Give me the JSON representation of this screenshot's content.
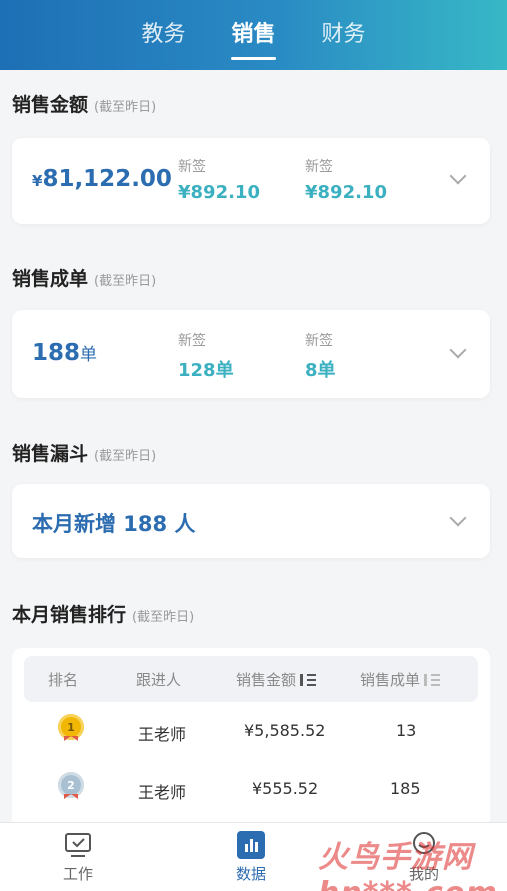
{
  "tabs": [
    "教务",
    "销售",
    "财务"
  ],
  "sales_amount": {
    "title": "销售金额",
    "subtitle": "(截至昨日)",
    "currency": "¥",
    "value": "81,122.00",
    "col1_label": "新签",
    "col1_value": "¥892.10",
    "col2_label": "新签",
    "col2_value": "¥892.10"
  },
  "sales_orders": {
    "title": "销售成单",
    "subtitle": "(截至昨日)",
    "value": "188",
    "unit": "单",
    "col1_label": "新签",
    "col1_value": "128单",
    "col2_label": "新签",
    "col2_value": "8单"
  },
  "funnel": {
    "title": "销售漏斗",
    "subtitle": "(截至昨日)",
    "text": "本月新增 188 人"
  },
  "ranking": {
    "title": "本月销售排行",
    "subtitle": "(截至昨日)",
    "headers": [
      "排名",
      "跟进人",
      "销售金额",
      "销售成单"
    ],
    "rows": [
      {
        "rank": "1",
        "name": "王老师",
        "amount": "¥5,585.52",
        "orders": "13"
      },
      {
        "rank": "2",
        "name": "王老师",
        "amount": "¥555.52",
        "orders": "185"
      }
    ]
  },
  "nav": [
    "工作",
    "数据",
    "我的"
  ],
  "watermark": "火鸟手游网 hn***.com",
  "colors": {
    "accent": "#2c6cb0",
    "teal": "#3bb0c0",
    "gold": "#f2b705",
    "silver": "#9fb6c8"
  }
}
